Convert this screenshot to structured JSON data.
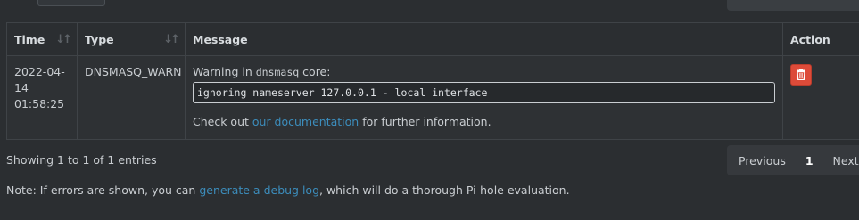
{
  "table": {
    "headers": {
      "time": "Time",
      "type": "Type",
      "message": "Message",
      "action": "Action"
    },
    "rows": [
      {
        "time_line1": "2022-04-",
        "time_line2": "14",
        "time_line3": "01:58:25",
        "type": "DNSMASQ_WARN",
        "warning_prefix": "Warning in ",
        "warning_code": "dnsmasq",
        "warning_suffix": " core:",
        "message": "ignoring nameserver 127.0.0.1 - local interface",
        "checkout_prefix": "Check out ",
        "doc_link": "our documentation",
        "checkout_suffix": " for further information."
      }
    ]
  },
  "footer": {
    "info": "Showing 1 to 1 of 1 entries",
    "previous": "Previous",
    "page": "1",
    "next": "Next"
  },
  "note": {
    "prefix": "Note: If errors are shown, you can ",
    "link": "generate a debug log",
    "suffix": ", which will do a thorough Pi-hole evaluation."
  },
  "colors": {
    "background": "#2b2e31",
    "link": "#3c8dbc",
    "delete": "#dd4b39"
  },
  "icons": {
    "sort": "sort-icon",
    "delete": "trash-icon"
  }
}
